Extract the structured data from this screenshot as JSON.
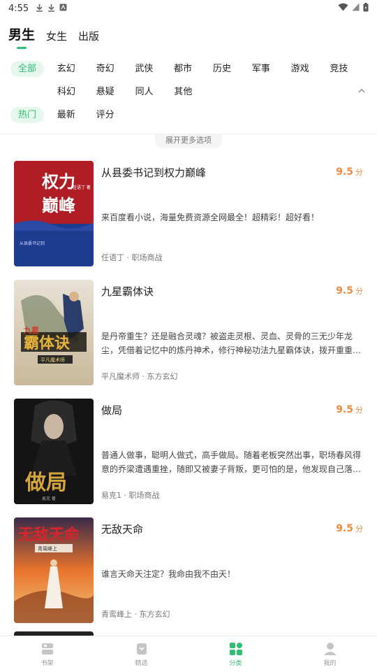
{
  "status": {
    "time": "4:55",
    "icons": [
      "download-icon",
      "download-icon",
      "notification-icon"
    ],
    "right_icons": [
      "wifi-icon",
      "signal-icon",
      "battery-icon"
    ]
  },
  "tabs": [
    {
      "label": "男生",
      "active": true
    },
    {
      "label": "女生",
      "active": false
    },
    {
      "label": "出版",
      "active": false
    }
  ],
  "filters": {
    "row1": [
      "全部",
      "玄幻",
      "奇幻",
      "武侠",
      "都市",
      "历史",
      "军事",
      "游戏",
      "竞技"
    ],
    "row2": [
      "科幻",
      "悬疑",
      "同人",
      "其他"
    ],
    "row3": [
      "热门",
      "最新",
      "评分"
    ],
    "expand_label": "展开更多选项"
  },
  "books": [
    {
      "title": "从县委书记到权力巅峰",
      "score": "9.5",
      "unit": "分",
      "desc": "来百度看小说，海量免费资源全网最全！超精彩！超好看！",
      "meta": "任语丁 · 职场商战",
      "cover_text": "权力巅峰",
      "cover_sub": "从县委书记到",
      "cover_author": "任语丁 著"
    },
    {
      "title": "九星霸体诀",
      "score": "9.5",
      "unit": "分",
      "desc": "是丹帝重生？还是融合灵魂？被盗走灵根、灵血、灵骨的三无少年龙尘，凭借着记忆中的炼丹神术，修行神秘功法九星霸体诀，拨开重重迷...",
      "meta": "平凡魔术师 · 东方玄幻",
      "cover_text": "霸体诀",
      "cover_sub": "九星",
      "cover_author": "平凡魔术师"
    },
    {
      "title": "做局",
      "score": "9.5",
      "unit": "分",
      "desc": "普通人做事，聪明人做式，高手做局。随着老板突然出事，职场春风得意的乔梁遭遇重挫，随即又被妻子背叛，更可怕的是，他发现自己落入...",
      "meta": "易克1 · 职场商战",
      "cover_text": "做局",
      "cover_sub": "",
      "cover_author": "易克 著"
    },
    {
      "title": "无敌天命",
      "score": "9.5",
      "unit": "分",
      "desc": "谁言天命天注定？我命由我不由天！",
      "meta": "青鸾峰上 · 东方玄幻",
      "cover_text": "无敌天命",
      "cover_sub": "青鸾峰上",
      "cover_author": ""
    }
  ],
  "nav": [
    {
      "label": "书架",
      "icon": "bookshelf-icon",
      "active": false
    },
    {
      "label": "精选",
      "icon": "featured-icon",
      "active": false
    },
    {
      "label": "分类",
      "icon": "category-icon",
      "active": true
    },
    {
      "label": "我的",
      "icon": "profile-icon",
      "active": false
    }
  ],
  "colors": {
    "accent": "#2fbf71",
    "score": "#f58a3f",
    "chip_bg": "#e6f7ee"
  }
}
